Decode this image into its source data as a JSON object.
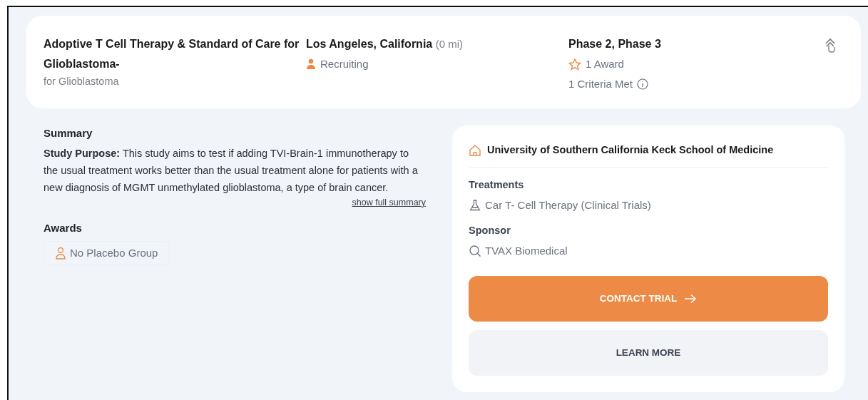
{
  "header": {
    "title": "Adoptive T Cell Therapy & Standard of Care for Glioblastoma-",
    "subtitle": "for Glioblastoma",
    "location": "Los Angeles, California",
    "distance": "(0 mi)",
    "status": "Recruiting",
    "phase": "Phase 2, Phase 3",
    "awards": "1 Award",
    "criteria": "1 Criteria Met"
  },
  "summary": {
    "heading": "Summary",
    "text": "**Study Purpose:** This study aims to test if adding TVI-Brain-1 immunotherapy to the usual treatment works better than the usual treatment alone for patients with a new diagnosis of MGMT unmethylated glioblastoma, a type of brain cancer.",
    "link": "show full summary"
  },
  "awards": {
    "heading": "Awards",
    "items": [
      "No Placebo Group"
    ]
  },
  "site": {
    "name": "University of Southern California Keck School of Medicine",
    "treatments_heading": "Treatments",
    "treatment": "Car T- Cell Therapy (Clinical Trials)",
    "sponsor_heading": "Sponsor",
    "sponsor": "TVAX Biomedical"
  },
  "buttons": [
    {
      "kind": "primary",
      "label": "CONTACT TRIAL"
    },
    {
      "kind": "secondary",
      "label": "LEARN MORE"
    }
  ]
}
